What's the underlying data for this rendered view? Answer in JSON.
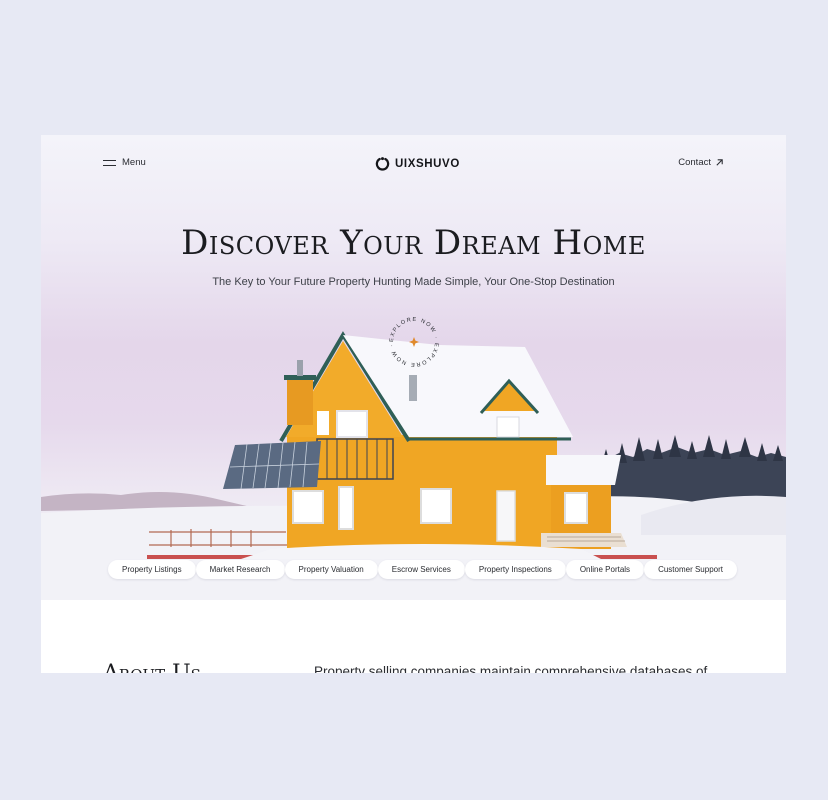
{
  "header": {
    "menu_label": "Menu",
    "brand": "UIXSHUVO",
    "contact_label": "Contact"
  },
  "hero": {
    "title": "Discover Your Dream Home",
    "subtitle": "The Key to Your Future Property Hunting Made Simple, Your One-Stop Destination",
    "badge_text": "EXPLORE NOW · EXPLORE NOW · "
  },
  "services": [
    "Property Listings",
    "Market Research",
    "Property Valuation",
    "Escrow Services",
    "Property Inspections",
    "Online Portals",
    "Customer Support"
  ],
  "about": {
    "title": "About Us",
    "text": "Property selling companies maintain comprehensive databases of"
  },
  "icons": {
    "menu": "hamburger-icon",
    "logo": "power-ring-icon",
    "contact": "arrow-up-right-icon",
    "badge": "sparkle-star-icon"
  },
  "colors": {
    "accent": "#e08a2c",
    "house": "#f0a624",
    "roof_trim": "#2f5f57",
    "page_bg": "#e7e9f4"
  }
}
